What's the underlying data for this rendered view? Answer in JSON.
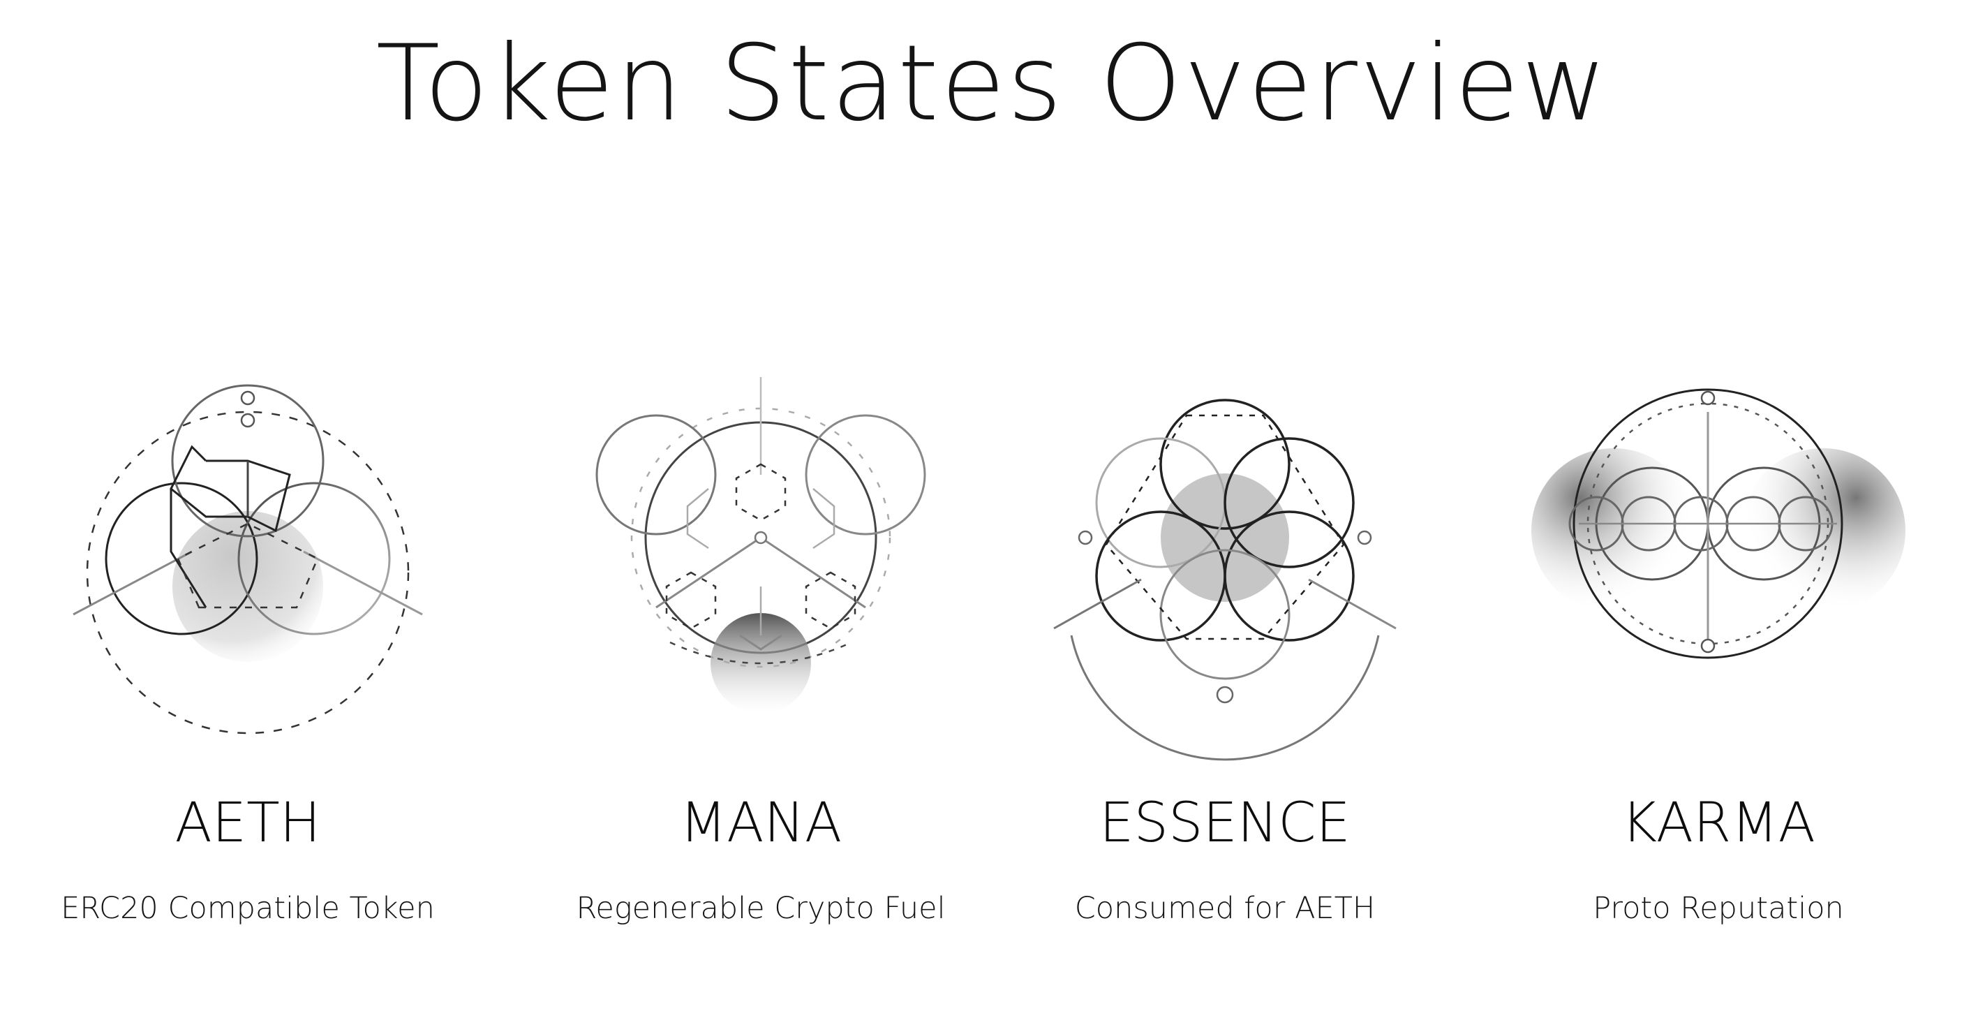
{
  "title": "Token States Overview",
  "tokens": [
    {
      "name": "AETH",
      "description": "ERC20 Compatible Token",
      "icon": "aeth-sacred-geometry-icon"
    },
    {
      "name": "MANA",
      "description": "Regenerable Crypto Fuel",
      "icon": "mana-sacred-geometry-icon"
    },
    {
      "name": "ESSENCE",
      "description": "Consumed for AETH",
      "icon": "essence-sacred-geometry-icon"
    },
    {
      "name": "KARMA",
      "description": "Proto Reputation",
      "icon": "karma-sacred-geometry-icon"
    }
  ],
  "colors": {
    "background": "#ffffff",
    "text": "#111111",
    "line_dark": "#222222",
    "line_light": "#aaaaaa"
  }
}
